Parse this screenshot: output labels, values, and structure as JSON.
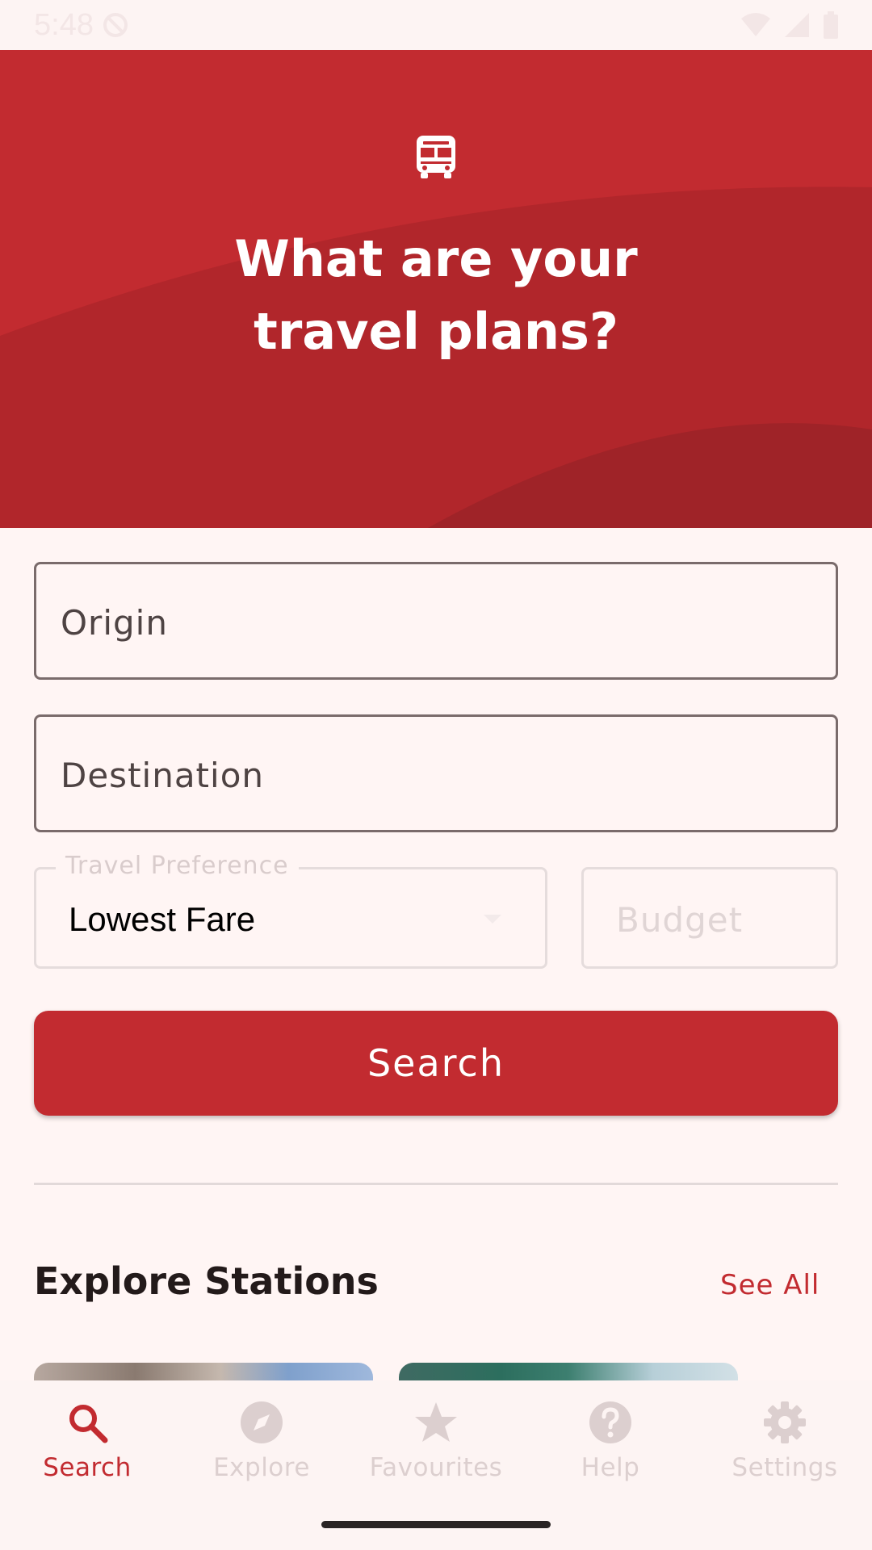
{
  "status_bar": {
    "time": "5:48"
  },
  "hero": {
    "icon": "bus-icon",
    "title_line1": "What are your",
    "title_line2": "travel plans?"
  },
  "form": {
    "origin_placeholder": "Origin",
    "destination_placeholder": "Destination",
    "travel_preference_label": "Travel Preference",
    "travel_preference_value": "Lowest Fare",
    "budget_placeholder": "Budget",
    "search_label": "Search"
  },
  "explore": {
    "title": "Explore Stations",
    "see_all": "See All"
  },
  "bottom_nav": {
    "items": [
      {
        "label": "Search",
        "icon": "search-icon",
        "active": true
      },
      {
        "label": "Explore",
        "icon": "compass-icon",
        "active": false
      },
      {
        "label": "Favourites",
        "icon": "star-icon",
        "active": false
      },
      {
        "label": "Help",
        "icon": "help-icon",
        "active": false
      },
      {
        "label": "Settings",
        "icon": "gear-icon",
        "active": false
      }
    ]
  },
  "colors": {
    "accent": "#c22b30",
    "background": "#fff5f4",
    "inactive": "#dccfcf"
  }
}
